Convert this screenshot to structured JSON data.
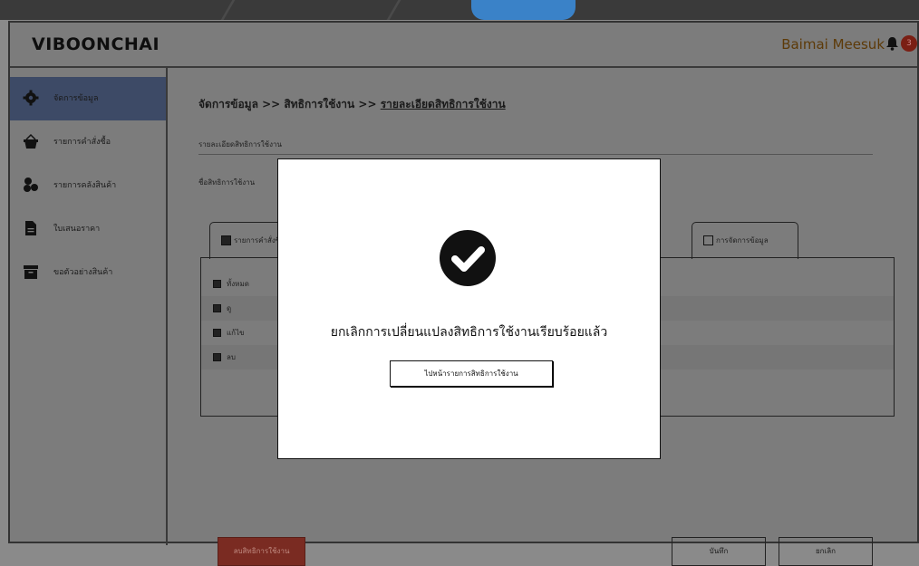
{
  "header": {
    "logo": "VIBOONCHAI",
    "user_name": "Baimai Meesuk",
    "notification_count": "3"
  },
  "sidebar": {
    "items": [
      {
        "label": "จัดการข้อมูล",
        "icon": "gear-icon",
        "active": true
      },
      {
        "label": "รายการคำสั่งซื้อ",
        "icon": "basket-icon",
        "active": false
      },
      {
        "label": "รายการคลังสินค้า",
        "icon": "boxes-icon",
        "active": false
      },
      {
        "label": "ใบเสนอราคา",
        "icon": "document-icon",
        "active": false
      },
      {
        "label": "ขอตัวอย่างสินค้า",
        "icon": "archive-icon",
        "active": false
      }
    ]
  },
  "main": {
    "breadcrumb": {
      "part1": "จัดการข้อมูล >> สิทธิการใช้งาน >> ",
      "current": "รายละเอียดสิทธิการใช้งาน"
    },
    "section_title": "รายละเอียดสิทธิการใช้งาน",
    "name_label": "ชื่อสิทธิการใช้งาน",
    "tabs": [
      {
        "label": "รายการคำสั่งซื้อ",
        "checked": true
      },
      {
        "label": "การจัดการข้อมูล",
        "checked": false
      }
    ],
    "permissions": [
      {
        "label": "ทั้งหมด"
      },
      {
        "label": "ดู"
      },
      {
        "label": "แก้ไข"
      },
      {
        "label": "ลบ"
      }
    ],
    "delete_button": "ลบสิทธิการใช้งาน",
    "save_button": "บันทึก",
    "cancel_button": "ยกเลิก"
  },
  "modal": {
    "message": "ยกเลิกการเปลี่ยนแปลงสิทธิการใช้งานเรียบร้อยแล้ว",
    "button": "ไปหน้ารายการสิทธิการใช้งาน",
    "icon": "check-circle-icon"
  }
}
